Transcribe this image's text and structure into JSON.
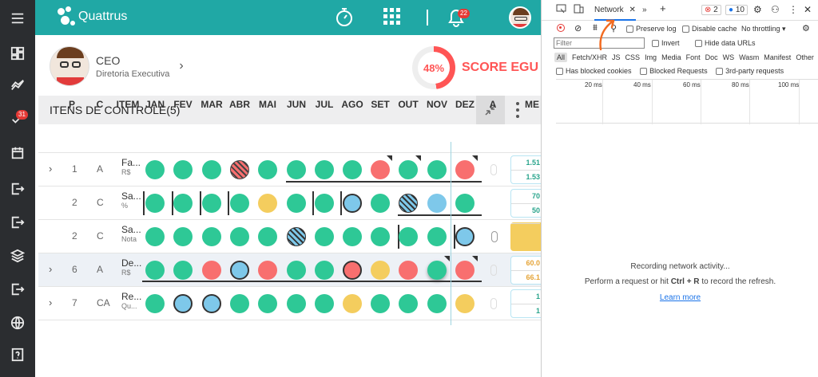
{
  "app": {
    "logo_text": "Quattrus",
    "brand_color": "#20a8a5"
  },
  "topbar": {
    "notification_count": "22"
  },
  "sidebar": {
    "pending_badge": "31",
    "items": [
      "menu-icon",
      "dashboard-icon",
      "trend-icon",
      "tasks-icon",
      "calendar-icon",
      "exit-icon",
      "exit-icon-2",
      "layers-icon",
      "exit-icon-3",
      "globe-icon",
      "help-icon"
    ]
  },
  "profile": {
    "role": "CEO",
    "department": "Diretoria Executiva"
  },
  "score": {
    "percent": "48%",
    "label": "SCORE EGU",
    "value": 0.48
  },
  "control": {
    "title": "ITENS DE CONTROLE(5)"
  },
  "table": {
    "headers": [
      "P",
      "C",
      "ITEM",
      "JAN",
      "FEV",
      "MAR",
      "ABR",
      "MAI",
      "JUN",
      "JUL",
      "AGO",
      "SET",
      "OUT",
      "NOV",
      "DEZ",
      "A",
      "ME"
    ],
    "rows": [
      {
        "p": "1",
        "c": "A",
        "item": "Fa...",
        "unit": "R$",
        "m1": "1.51",
        "m2": "1.53"
      },
      {
        "p": "2",
        "c": "C",
        "item": "Sa...",
        "unit": "%",
        "m1": "70",
        "m2": "50"
      },
      {
        "p": "2",
        "c": "C",
        "item": "Sa...",
        "unit": "Nota",
        "m1": "",
        "m2": ""
      },
      {
        "p": "6",
        "c": "A",
        "item": "De...",
        "unit": "R$",
        "m1": "60.0",
        "m2": "66.1"
      },
      {
        "p": "7",
        "c": "CA",
        "item": "Re...",
        "unit": "Qu...",
        "m1": "1",
        "m2": "1"
      }
    ]
  },
  "devtools": {
    "tab_network": "Network",
    "error_count": "2",
    "message_count": "10",
    "filter_placeholder": "Filter",
    "preserve_log": "Preserve log",
    "disable_cache": "Disable cache",
    "throttling": "No throttling",
    "invert": "Invert",
    "hide_data_urls": "Hide data URLs",
    "types": [
      "All",
      "Fetch/XHR",
      "JS",
      "CSS",
      "Img",
      "Media",
      "Font",
      "Doc",
      "WS",
      "Wasm",
      "Manifest",
      "Other"
    ],
    "has_blocked_cookies": "Has blocked cookies",
    "blocked_requests": "Blocked Requests",
    "third_party": "3rd-party requests",
    "timeline_marks": [
      "20 ms",
      "40 ms",
      "60 ms",
      "80 ms",
      "100 ms"
    ],
    "recording": "Recording network activity...",
    "hint_pre": "Perform a request or hit",
    "hint_key": "Ctrl + R",
    "hint_post": "to record the refresh.",
    "learn_more": "Learn more"
  }
}
